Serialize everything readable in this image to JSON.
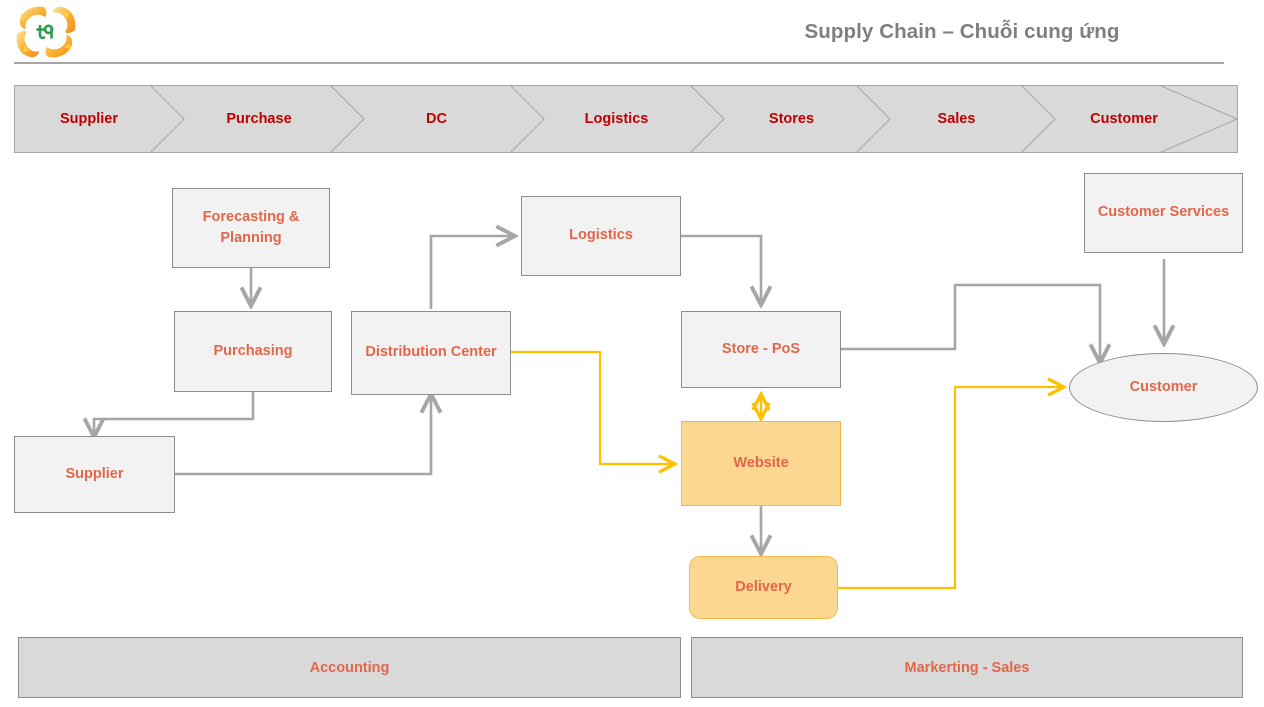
{
  "header": {
    "title": "Supply Chain – Chuỗi cung ứng",
    "logo_name": "koi-fish-logo"
  },
  "chevron_band": {
    "items": [
      {
        "label": "Supplier"
      },
      {
        "label": "Purchase"
      },
      {
        "label": "DC"
      },
      {
        "label": "Logistics"
      },
      {
        "label": "Stores"
      },
      {
        "label": "Sales"
      },
      {
        "label": "Customer"
      }
    ],
    "fill": "#d9d9d9",
    "text_color": "#c00000"
  },
  "nodes": {
    "forecasting": "Forecasting & Planning",
    "purchasing": "Purchasing",
    "supplier": "Supplier",
    "distribution_center": "Distribution Center",
    "logistics": "Logistics",
    "store_pos": "Store - PoS",
    "website": "Website",
    "delivery": "Delivery",
    "customer_services": "Customer Services",
    "customer": "Customer"
  },
  "footer_bands": {
    "accounting": "Accounting",
    "marketing_sales": "Markerting - Sales"
  },
  "colors": {
    "node_text": "#e2674a",
    "grey_fill": "#f2f2f2",
    "grey_border": "#8c8c8c",
    "orange_fill": "#fcd791",
    "orange_border": "#f5b942",
    "band_fill": "#d9d9d9",
    "chevron_text": "#c00000",
    "title_text": "#7f7f7f",
    "connector_grey": "#a6a6a6",
    "connector_yellow": "#ffc000"
  }
}
